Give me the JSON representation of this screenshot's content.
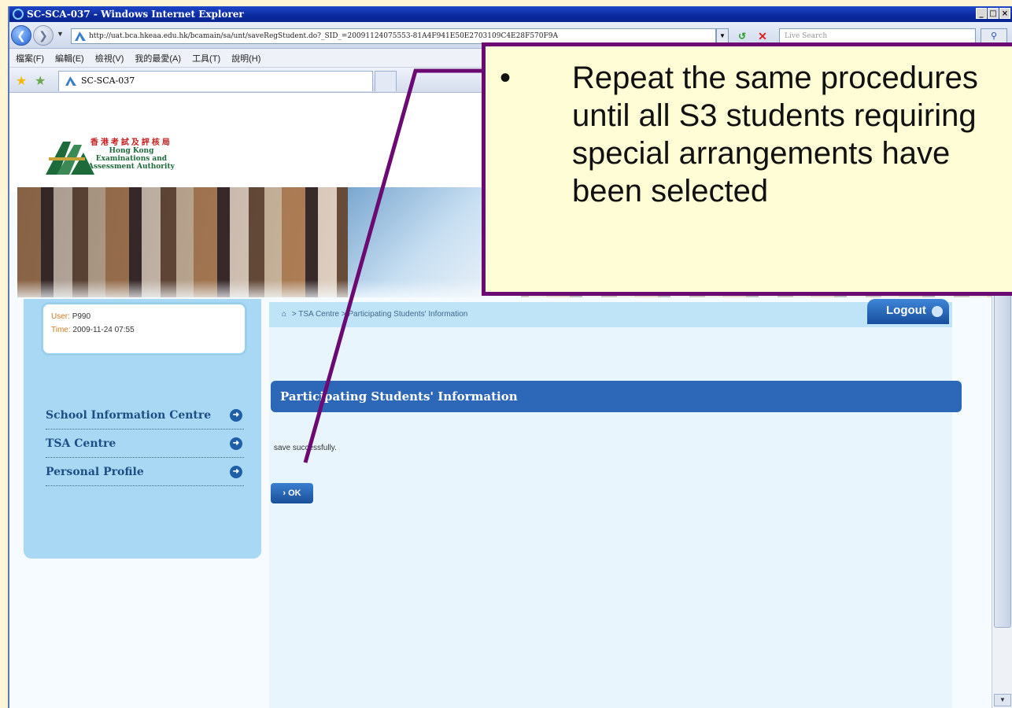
{
  "browser": {
    "window_title": "SC-SCA-037 - Windows Internet Explorer",
    "url": "http://uat.bca.hkeaa.edu.hk/bcamain/sa/unt/saveRegStudent.do?_SID_=20091124075553-81A4F941E50E2703109C4E28F570F9A",
    "search_placeholder": "Live Search",
    "menu": [
      "檔案(F)",
      "編輯(E)",
      "檢視(V)",
      "我的最愛(A)",
      "工具(T)",
      "說明(H)"
    ],
    "tab_title": "SC-SCA-037",
    "window_controls": [
      "_",
      "□",
      "×"
    ]
  },
  "logo": {
    "zh": "香港考試及評核局",
    "en_line1": "Hong Kong",
    "en_line2": "Examinations and",
    "en_line3": "Assessment Authority"
  },
  "user_box": {
    "user_label": "User:",
    "user_value": "P990",
    "time_label": "Time:",
    "time_value": "2009-11-24 07:55"
  },
  "sidebar": {
    "items": [
      {
        "label": "School Information Centre"
      },
      {
        "label": "TSA Centre"
      },
      {
        "label": "Personal Profile"
      }
    ]
  },
  "breadcrumb": {
    "part1": "> TSA Centre",
    "part2": "> Participating Students' Information"
  },
  "logout_label": "Logout",
  "main": {
    "section_title": "Participating Students' Information",
    "message": "save successfully.",
    "ok_label": "OK"
  },
  "callout": {
    "bullet": "•",
    "line1": "Repeat the same procedures",
    "line2": "until all S3 students requiring",
    "line3": "special arrangements have",
    "line4": "been selected"
  },
  "colors": {
    "callout_border": "#6b0a73",
    "callout_fill": "#fffdd6",
    "section_header": "#2d67b8",
    "sidebar_bg": "#a8d8f3"
  }
}
